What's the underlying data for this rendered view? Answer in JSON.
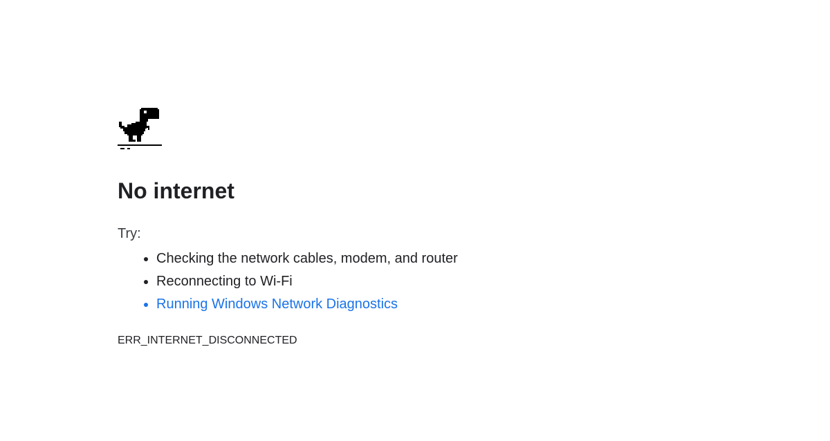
{
  "page": {
    "title": "No internet",
    "try_label": "Try:",
    "suggestions": [
      "Checking the network cables, modem, and router",
      "Reconnecting to Wi-Fi"
    ],
    "diagnostics_link": "Running Windows Network Diagnostics",
    "error_code": "ERR_INTERNET_DISCONNECTED",
    "icon": "offline-dinosaur-icon"
  },
  "colors": {
    "text": "#202124",
    "link": "#1a73e8",
    "background": "#ffffff"
  }
}
